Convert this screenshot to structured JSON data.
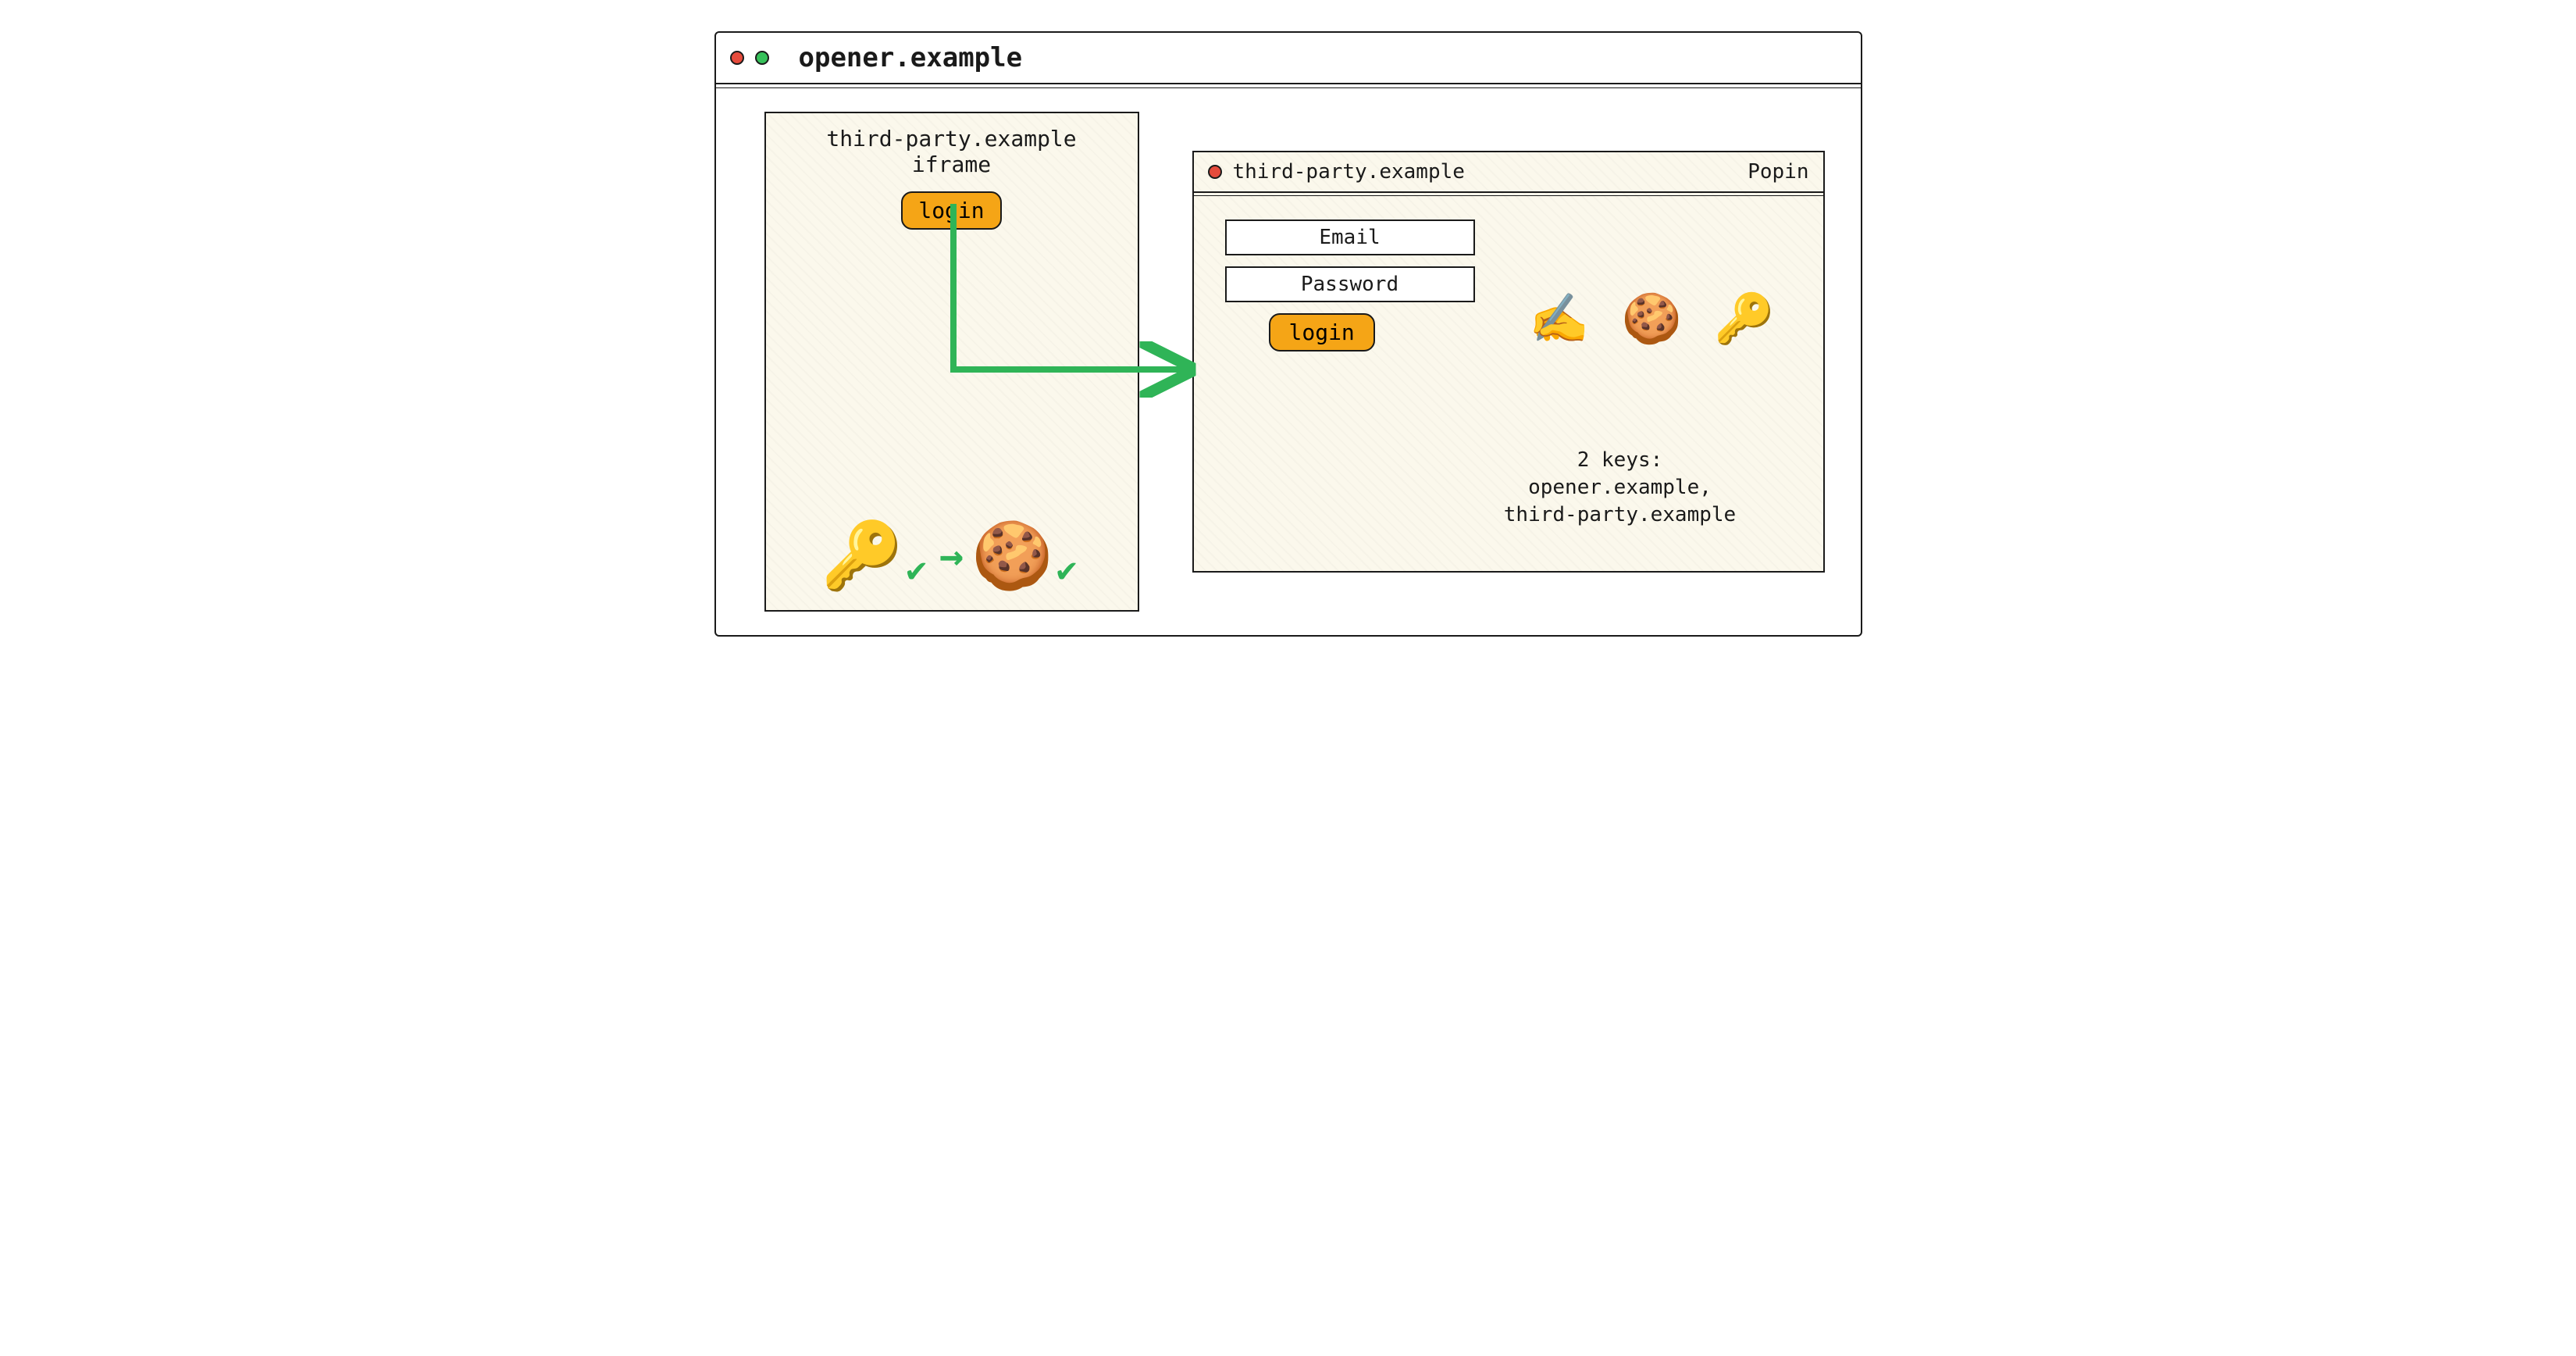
{
  "window": {
    "title": "opener.example"
  },
  "iframe": {
    "title": "third-party.example iframe",
    "login_label": "login"
  },
  "popin": {
    "title": "third-party.example",
    "badge": "Popin",
    "email_label": "Email",
    "password_label": "Password",
    "login_label": "login",
    "keys_heading": "2 keys:",
    "keys_line1": "opener.example,",
    "keys_line2": "third-party.example"
  },
  "icons": {
    "key": "🔑",
    "cookie": "🍪",
    "writing_hand": "✍️",
    "check": "✔",
    "arrow_right": "→"
  }
}
